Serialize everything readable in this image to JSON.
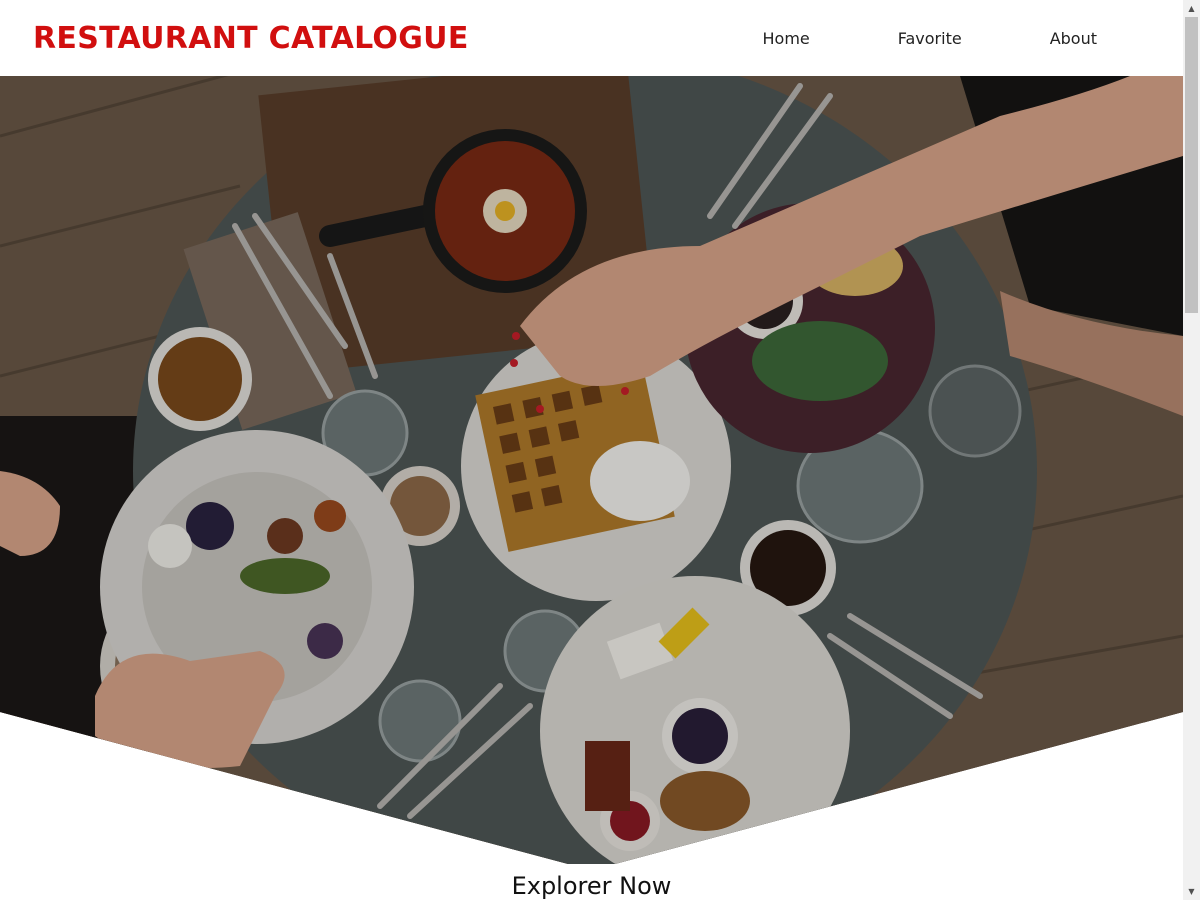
{
  "header": {
    "brand": "RESTAURANT CATALOGUE",
    "nav": [
      {
        "label": "Home"
      },
      {
        "label": "Favorite"
      },
      {
        "label": "About"
      }
    ]
  },
  "hero": {
    "image_alt": "Overhead view of a breakfast table with waffles, shakshuka, coffee and plates"
  },
  "explore": {
    "heading": "Explorer Now"
  },
  "colors": {
    "brand": "#d10f0f",
    "text": "#222222",
    "background": "#ffffff"
  }
}
